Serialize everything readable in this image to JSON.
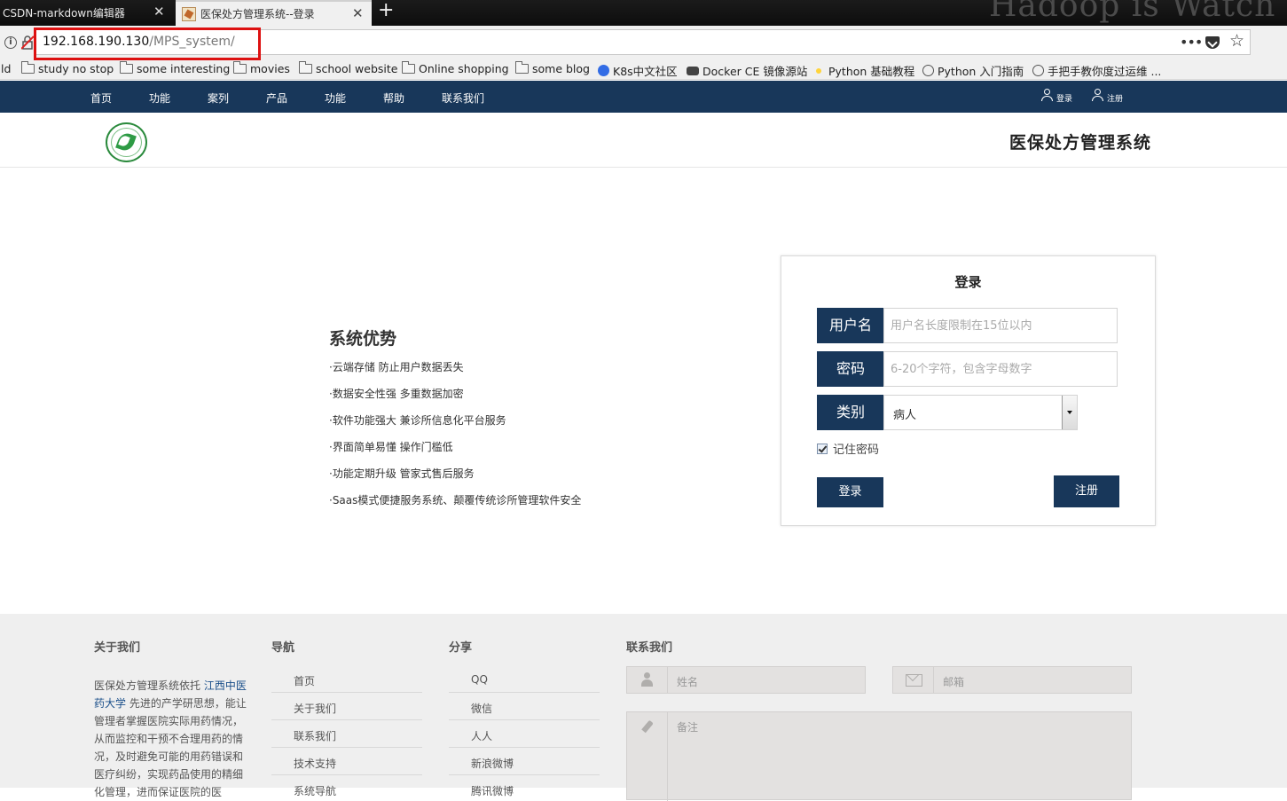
{
  "browser": {
    "tabs": [
      {
        "title": "CSDN-markdown编辑器",
        "close": "✕"
      },
      {
        "title": "医保处方管理系统--登录",
        "close": "✕"
      }
    ],
    "new_tab": "+",
    "watermark": "Hadoop  is  Watch",
    "url_host": "192.168.190.130",
    "url_path": "/MPS_system/",
    "page_actions": "•••",
    "bookmark_icon": "☆",
    "bookmarks": [
      {
        "label": "ld",
        "icon": "none"
      },
      {
        "label": "study no stop",
        "icon": "folder-icon"
      },
      {
        "label": "some interesting",
        "icon": "folder-icon"
      },
      {
        "label": "movies",
        "icon": "folder-icon"
      },
      {
        "label": "school website",
        "icon": "folder-icon"
      },
      {
        "label": "Online shopping",
        "icon": "folder-icon"
      },
      {
        "label": "some blog",
        "icon": "folder-icon"
      },
      {
        "label": "K8s中文社区",
        "icon": "kubernetes-icon"
      },
      {
        "label": "Docker CE 镜像源站",
        "icon": "docker-icon"
      },
      {
        "label": "Python 基础教程",
        "icon": "python-icon"
      },
      {
        "label": "Python 入门指南",
        "icon": "globe-icon"
      },
      {
        "label": "手把手教你度过运维 ...",
        "icon": "globe-icon"
      }
    ]
  },
  "site": {
    "nav": [
      "首页",
      "功能",
      "案列",
      "产品",
      "功能",
      "帮助",
      "联系我们"
    ],
    "login_link": "登录",
    "register_link": "注册",
    "title": "医保处方管理系统",
    "brand_color": "#18375a"
  },
  "advantages": {
    "title": "系统优势",
    "items": [
      "·云端存储 防止用户数据丢失",
      "·数据安全性强 多重数据加密",
      "·软件功能强大 兼诊所信息化平台服务",
      "·界面简单易懂 操作门槛低",
      "·功能定期升级 管家式售后服务",
      "·Saas模式便捷服务系统、颠覆传统诊所管理软件安全"
    ]
  },
  "login": {
    "title": "登录",
    "username_label": "用户名",
    "username_placeholder": "用户名长度限制在15位以内",
    "password_label": "密码",
    "password_placeholder": "6-20个字符，包含字母数字",
    "category_label": "类别",
    "category_value": "病人",
    "remember_label": "记住密码",
    "remember_checked": true,
    "login_button": "登录",
    "register_button": "注册"
  },
  "footer": {
    "about_title": "关于我们",
    "about_text_before": "医保处方管理系统依托 ",
    "about_link": "江西中医药大学",
    "about_text_after": " 先进的产学研思想，能让管理者掌握医院实际用药情况，从而监控和干预不合理用药的情况，及时避免可能的用药错误和医疗纠纷，实现药品使用的精细化管理，进而保证医院的医",
    "nav_title": "导航",
    "nav_links": [
      "首页",
      "关于我们",
      "联系我们",
      "技术支持",
      "系统导航"
    ],
    "share_title": "分享",
    "share_links": [
      "QQ",
      "微信",
      "人人",
      "新浪微博",
      "腾讯微博"
    ],
    "contact_title": "联系我们",
    "name_placeholder": "姓名",
    "email_placeholder": "邮箱",
    "remark_placeholder": "备注"
  }
}
